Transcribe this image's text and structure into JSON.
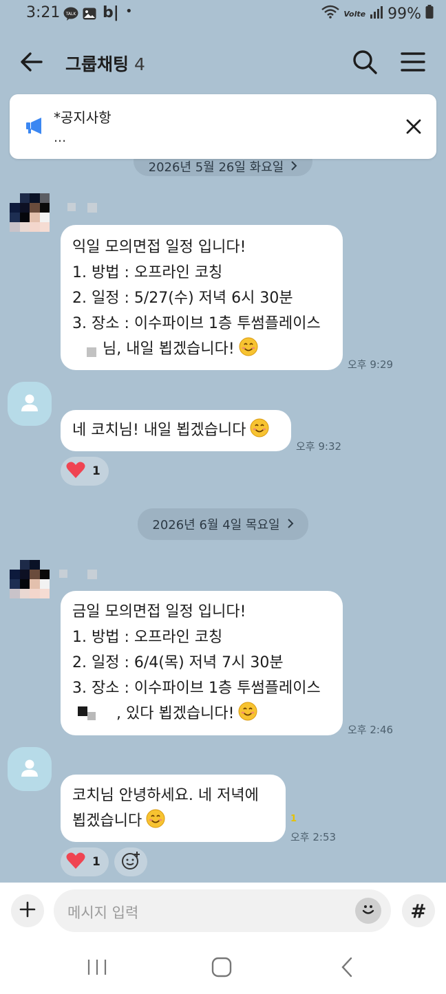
{
  "status_bar": {
    "time": "3:21",
    "app_text": "b|",
    "dot": "•",
    "network": "Volte",
    "battery": "99%"
  },
  "header": {
    "title": "그룹채팅",
    "member_count": "4"
  },
  "notice": {
    "title": "*공지사항",
    "body": "..."
  },
  "date_pills": [
    {
      "label": "2026년 5월 26일 화요일"
    },
    {
      "label": "2026년 6월 4일 목요일"
    }
  ],
  "messages": [
    {
      "lines": [
        "익일 모의면접 일정 입니다!",
        "1. 방법 : 오프라인 코칭",
        "2. 일정 : 5/27(수) 저녁 6시 30분",
        "3. 장소 : 이수파이브 1층 투썸플레이스",
        "님, 내일 뵙겠습니다!"
      ],
      "time": "오후 9:29"
    },
    {
      "lines": [
        "네 코치님! 내일 뵙겠습니다"
      ],
      "time": "오후 9:32",
      "reaction_count": "1"
    },
    {
      "lines": [
        "금일 모의면접 일정 입니다!",
        "1. 방법 : 오프라인 코칭",
        "2. 일정 : 6/4(목) 저녁 7시 30분",
        "3. 장소 : 이수파이브 1층 투썸플레이스",
        ", 있다 뵙겠습니다!"
      ],
      "time": "오후 2:46"
    },
    {
      "lines": [
        "코치님 안녕하세요. 네 저녁에",
        "뵙겠습니다"
      ],
      "time": "오후 2:53",
      "unread": "1",
      "reaction_count": "1"
    }
  ],
  "input": {
    "placeholder": "메시지 입력",
    "hash": "#"
  },
  "colors": {
    "chat_background": "#abc1d1",
    "bubble": "#ffffff",
    "unread": "#e6c200",
    "heart": "#ef4452"
  }
}
